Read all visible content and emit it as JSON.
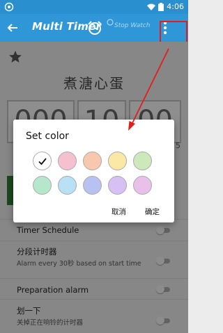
{
  "status_bar": {
    "time": "4:06"
  },
  "app_bar": {
    "title": "Multi Timer",
    "secondary_label": "Stop Watch"
  },
  "timer": {
    "name": "煮溏心蛋",
    "digits": [
      "000",
      "10",
      "00"
    ],
    "side_number": "5"
  },
  "settings_rows": [
    {
      "title": "Timer Schedule",
      "subtitle": ""
    },
    {
      "title": "分段计时器",
      "subtitle": "Alarm every 30秒 based on start time"
    },
    {
      "title": "Preparation alarm",
      "subtitle": ""
    },
    {
      "title": "划一下",
      "subtitle": "关掉正在响铃的计时器"
    }
  ],
  "dialog": {
    "title": "Set color",
    "cancel_label": "取消",
    "ok_label": "确定",
    "colors": [
      "#ffffff",
      "#f6c1cf",
      "#f7c8ad",
      "#fbe8a7",
      "#cde8bb",
      "#b6e7cc",
      "#b9e1f6",
      "#b8c2f2",
      "#d6c0f4",
      "#e8c0ea"
    ],
    "selected_index": 0
  },
  "annotation": {
    "color": "#e31d1d"
  }
}
